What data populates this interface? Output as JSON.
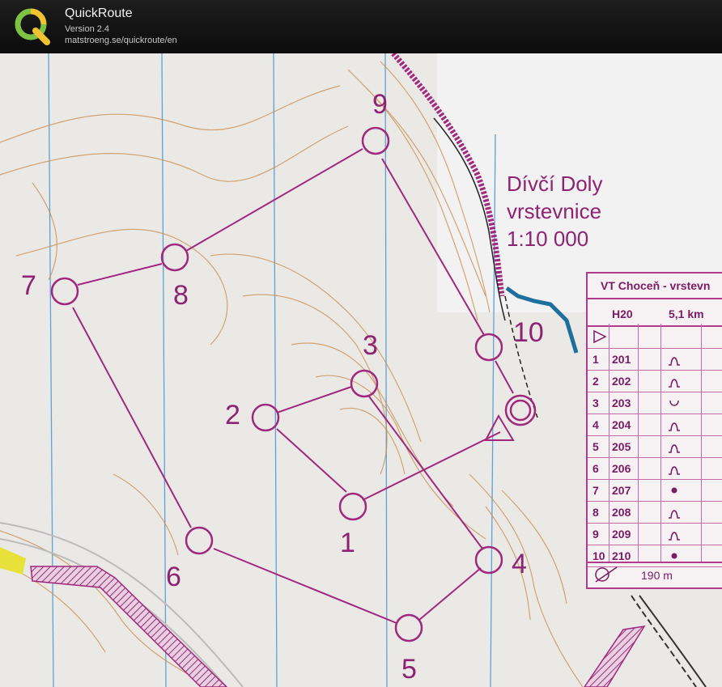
{
  "app": {
    "title": "QuickRoute",
    "version": "Version 2.4",
    "url": "matstroeng.se/quickroute/en"
  },
  "map": {
    "name_lines": [
      "Dívčí Doly",
      "vrstevnice",
      "1:10 000"
    ],
    "controls": [
      "1",
      "2",
      "3",
      "4",
      "5",
      "6",
      "7",
      "8",
      "9",
      "10"
    ],
    "accent_color": "#a0287e"
  },
  "legend": {
    "title": "VT Choceň - vrstevn",
    "class": "H20",
    "length": "5,1 km",
    "rows": [
      {
        "n": "1",
        "code": "201",
        "symbol": "bump"
      },
      {
        "n": "2",
        "code": "202",
        "symbol": "bump"
      },
      {
        "n": "3",
        "code": "203",
        "symbol": "pit"
      },
      {
        "n": "4",
        "code": "204",
        "symbol": "bump"
      },
      {
        "n": "5",
        "code": "205",
        "symbol": "bump"
      },
      {
        "n": "6",
        "code": "206",
        "symbol": "bump"
      },
      {
        "n": "7",
        "code": "207",
        "symbol": "dot"
      },
      {
        "n": "8",
        "code": "208",
        "symbol": "bump"
      },
      {
        "n": "9",
        "code": "209",
        "symbol": "bump"
      },
      {
        "n": "10",
        "code": "210",
        "symbol": "dot"
      }
    ],
    "finish_distance": "190 m"
  }
}
